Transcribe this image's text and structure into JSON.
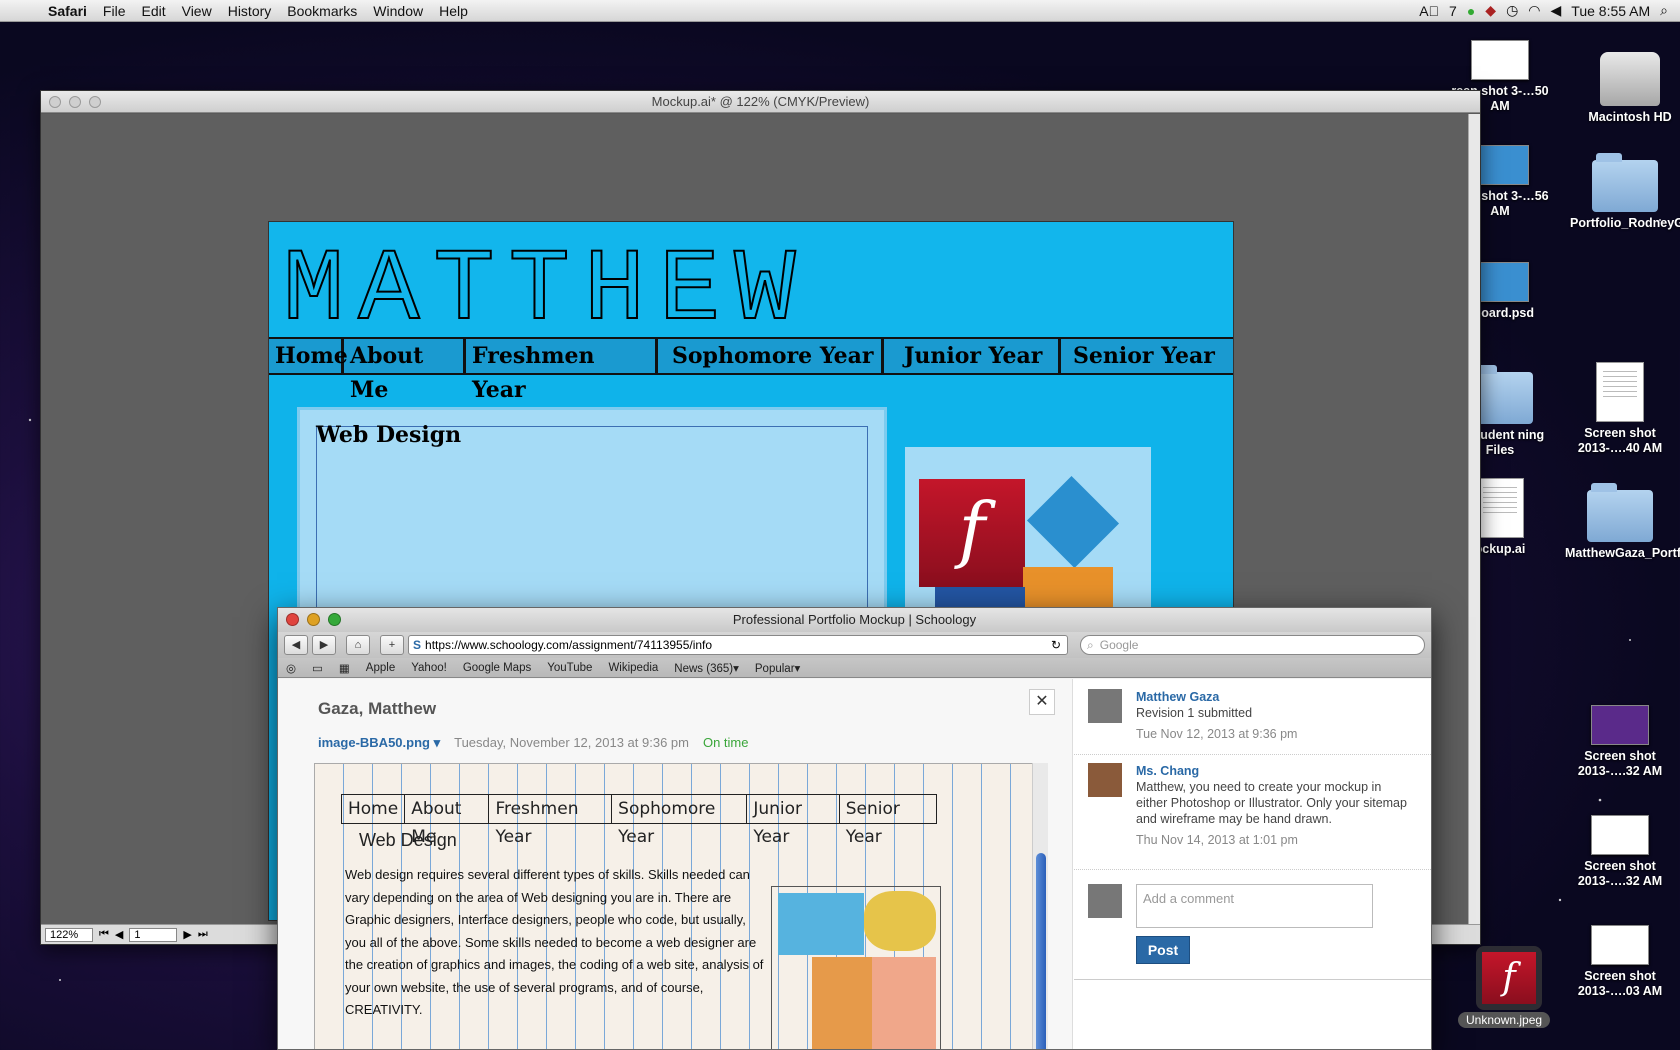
{
  "menubar": {
    "app": "Safari",
    "items": [
      "File",
      "Edit",
      "View",
      "History",
      "Bookmarks",
      "Window",
      "Help"
    ],
    "status_a_count": "7",
    "clock": "Tue 8:55 AM"
  },
  "desktop": {
    "icons": [
      {
        "label": "reen shot 3-…50 AM",
        "type": "thumb"
      },
      {
        "label": "Macintosh HD",
        "type": "hd"
      },
      {
        "label": "reen shot 3-…56 AM",
        "type": "thumb"
      },
      {
        "label": "Portfolio_RodneyGarvey",
        "type": "folder"
      },
      {
        "label": "dboard.psd",
        "type": "thumb"
      },
      {
        "label": "S Student ning Files",
        "type": "folder"
      },
      {
        "label": "Screen shot 2013-….40 AM",
        "type": "doc"
      },
      {
        "label": "ockup.ai",
        "type": "doc"
      },
      {
        "label": "MatthewGaza_Portfolio",
        "type": "folder"
      },
      {
        "label": "Screen shot 2013-….32 AM",
        "type": "thumb"
      },
      {
        "label": "Screen shot 2013-….32 AM",
        "type": "thumb"
      },
      {
        "label": "Screen shot 2013-….03 AM",
        "type": "thumb"
      }
    ],
    "dock_label": "Unknown.jpeg"
  },
  "illustrator": {
    "title": "Mockup.ai* @ 122% (CMYK/Preview)",
    "zoom": "122%",
    "page": "1",
    "artboard": {
      "banner_text": "MATTHEW",
      "nav": [
        "Home",
        "About Me",
        "Freshmen Year",
        "Sophomore Year",
        "Junior Year",
        "Senior Year"
      ],
      "content_title": "Web Design"
    }
  },
  "safari": {
    "title": "Professional Portfolio Mockup | Schoology",
    "url": "https://www.schoology.com/assignment/74113955/info",
    "search_placeholder": "Google",
    "bookmarks": [
      "Apple",
      "Yahoo!",
      "Google Maps",
      "YouTube",
      "Wikipedia",
      "News (365)",
      "Popular"
    ],
    "student": "Gaza, Matthew",
    "file": "image-BBA50.png",
    "submitted": "Tuesday, November 12, 2013 at 9:36 pm",
    "status": "On time",
    "sketch": {
      "nav": [
        "Home",
        "About Me",
        "Freshmen Year",
        "Sophomore Year",
        "Junior Year",
        "Senior Year"
      ],
      "title": "Web Design",
      "text": "Web design requires several different types of skills. Skills needed can vary depending on the area of Web designing you are in. There are Graphic designers, Interface designers, people who code, but usually, you all of the above. Some skills needed to become a web designer are the creation of graphics and images, the coding of a web site, analysis of your own website, the use of several programs, and of course, CREATIVITY."
    },
    "comments": [
      {
        "name": "Matthew Gaza",
        "text": "Revision 1 submitted",
        "time": "Tue Nov 12, 2013 at 9:36 pm"
      },
      {
        "name": "Ms. Chang",
        "text": "Matthew, you need to create your mockup in either Photoshop or Illustrator. Only your sitemap and wireframe may be hand drawn.",
        "time": "Thu Nov 14, 2013 at 1:01 pm"
      }
    ],
    "add_comment_placeholder": "Add a comment",
    "post_label": "Post"
  }
}
